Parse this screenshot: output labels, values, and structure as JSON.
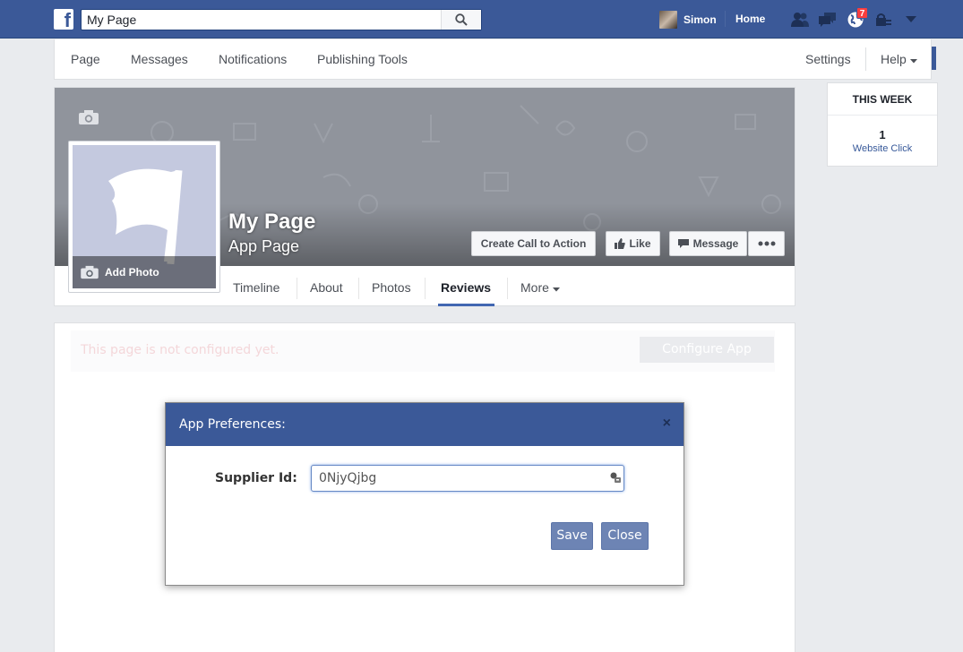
{
  "topbar": {
    "logo": "f",
    "search_value": "My Page",
    "user_name": "Simon",
    "home_label": "Home",
    "notification_count": "7"
  },
  "pagenav": {
    "items": [
      "Page",
      "Messages",
      "Notifications",
      "Publishing Tools"
    ],
    "settings_label": "Settings",
    "help_label": "Help"
  },
  "page": {
    "title": "My Page",
    "subtitle": "App Page",
    "add_photo_label": "Add Photo",
    "buttons": {
      "cta": "Create Call to Action",
      "like": "Like",
      "message": "Message"
    },
    "tabs": [
      "Timeline",
      "About",
      "Photos",
      "Reviews",
      "More"
    ]
  },
  "sidebar": {
    "this_week_title": "THIS WEEK",
    "stat_value": "1",
    "stat_label": "Website Click"
  },
  "content": {
    "notice": "This page is not configured yet.",
    "configure_button": "Configure App"
  },
  "modal": {
    "title": "App Preferences:",
    "close_glyph": "×",
    "field_label": "Supplier Id:",
    "field_value": "0NjyQjbg",
    "save_label": "Save",
    "close_label": "Close"
  },
  "colors": {
    "brand": "#3b5998",
    "modal_button": "#6d84b4",
    "badge": "#fa3e3e"
  }
}
